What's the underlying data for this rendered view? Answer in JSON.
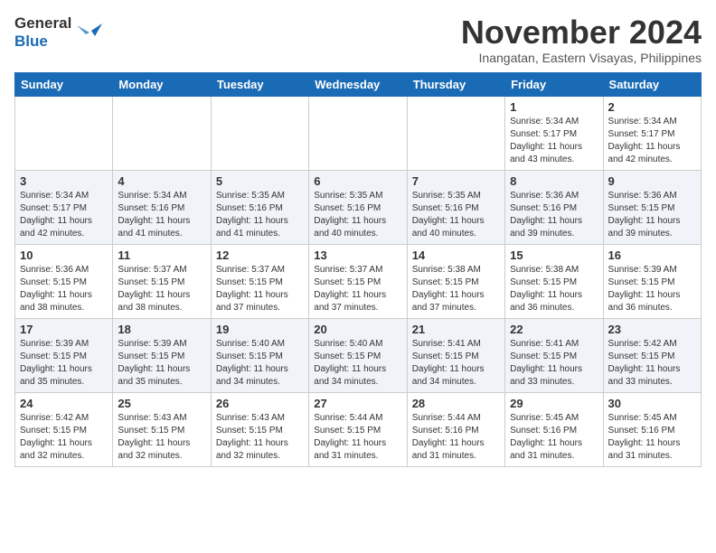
{
  "header": {
    "logo_line1": "General",
    "logo_line2": "Blue",
    "month_title": "November 2024",
    "location": "Inangatan, Eastern Visayas, Philippines"
  },
  "weekdays": [
    "Sunday",
    "Monday",
    "Tuesday",
    "Wednesday",
    "Thursday",
    "Friday",
    "Saturday"
  ],
  "weeks": [
    [
      {
        "day": "",
        "info": ""
      },
      {
        "day": "",
        "info": ""
      },
      {
        "day": "",
        "info": ""
      },
      {
        "day": "",
        "info": ""
      },
      {
        "day": "",
        "info": ""
      },
      {
        "day": "1",
        "info": "Sunrise: 5:34 AM\nSunset: 5:17 PM\nDaylight: 11 hours and 43 minutes."
      },
      {
        "day": "2",
        "info": "Sunrise: 5:34 AM\nSunset: 5:17 PM\nDaylight: 11 hours and 42 minutes."
      }
    ],
    [
      {
        "day": "3",
        "info": "Sunrise: 5:34 AM\nSunset: 5:17 PM\nDaylight: 11 hours and 42 minutes."
      },
      {
        "day": "4",
        "info": "Sunrise: 5:34 AM\nSunset: 5:16 PM\nDaylight: 11 hours and 41 minutes."
      },
      {
        "day": "5",
        "info": "Sunrise: 5:35 AM\nSunset: 5:16 PM\nDaylight: 11 hours and 41 minutes."
      },
      {
        "day": "6",
        "info": "Sunrise: 5:35 AM\nSunset: 5:16 PM\nDaylight: 11 hours and 40 minutes."
      },
      {
        "day": "7",
        "info": "Sunrise: 5:35 AM\nSunset: 5:16 PM\nDaylight: 11 hours and 40 minutes."
      },
      {
        "day": "8",
        "info": "Sunrise: 5:36 AM\nSunset: 5:16 PM\nDaylight: 11 hours and 39 minutes."
      },
      {
        "day": "9",
        "info": "Sunrise: 5:36 AM\nSunset: 5:15 PM\nDaylight: 11 hours and 39 minutes."
      }
    ],
    [
      {
        "day": "10",
        "info": "Sunrise: 5:36 AM\nSunset: 5:15 PM\nDaylight: 11 hours and 38 minutes."
      },
      {
        "day": "11",
        "info": "Sunrise: 5:37 AM\nSunset: 5:15 PM\nDaylight: 11 hours and 38 minutes."
      },
      {
        "day": "12",
        "info": "Sunrise: 5:37 AM\nSunset: 5:15 PM\nDaylight: 11 hours and 37 minutes."
      },
      {
        "day": "13",
        "info": "Sunrise: 5:37 AM\nSunset: 5:15 PM\nDaylight: 11 hours and 37 minutes."
      },
      {
        "day": "14",
        "info": "Sunrise: 5:38 AM\nSunset: 5:15 PM\nDaylight: 11 hours and 37 minutes."
      },
      {
        "day": "15",
        "info": "Sunrise: 5:38 AM\nSunset: 5:15 PM\nDaylight: 11 hours and 36 minutes."
      },
      {
        "day": "16",
        "info": "Sunrise: 5:39 AM\nSunset: 5:15 PM\nDaylight: 11 hours and 36 minutes."
      }
    ],
    [
      {
        "day": "17",
        "info": "Sunrise: 5:39 AM\nSunset: 5:15 PM\nDaylight: 11 hours and 35 minutes."
      },
      {
        "day": "18",
        "info": "Sunrise: 5:39 AM\nSunset: 5:15 PM\nDaylight: 11 hours and 35 minutes."
      },
      {
        "day": "19",
        "info": "Sunrise: 5:40 AM\nSunset: 5:15 PM\nDaylight: 11 hours and 34 minutes."
      },
      {
        "day": "20",
        "info": "Sunrise: 5:40 AM\nSunset: 5:15 PM\nDaylight: 11 hours and 34 minutes."
      },
      {
        "day": "21",
        "info": "Sunrise: 5:41 AM\nSunset: 5:15 PM\nDaylight: 11 hours and 34 minutes."
      },
      {
        "day": "22",
        "info": "Sunrise: 5:41 AM\nSunset: 5:15 PM\nDaylight: 11 hours and 33 minutes."
      },
      {
        "day": "23",
        "info": "Sunrise: 5:42 AM\nSunset: 5:15 PM\nDaylight: 11 hours and 33 minutes."
      }
    ],
    [
      {
        "day": "24",
        "info": "Sunrise: 5:42 AM\nSunset: 5:15 PM\nDaylight: 11 hours and 32 minutes."
      },
      {
        "day": "25",
        "info": "Sunrise: 5:43 AM\nSunset: 5:15 PM\nDaylight: 11 hours and 32 minutes."
      },
      {
        "day": "26",
        "info": "Sunrise: 5:43 AM\nSunset: 5:15 PM\nDaylight: 11 hours and 32 minutes."
      },
      {
        "day": "27",
        "info": "Sunrise: 5:44 AM\nSunset: 5:15 PM\nDaylight: 11 hours and 31 minutes."
      },
      {
        "day": "28",
        "info": "Sunrise: 5:44 AM\nSunset: 5:16 PM\nDaylight: 11 hours and 31 minutes."
      },
      {
        "day": "29",
        "info": "Sunrise: 5:45 AM\nSunset: 5:16 PM\nDaylight: 11 hours and 31 minutes."
      },
      {
        "day": "30",
        "info": "Sunrise: 5:45 AM\nSunset: 5:16 PM\nDaylight: 11 hours and 31 minutes."
      }
    ]
  ]
}
